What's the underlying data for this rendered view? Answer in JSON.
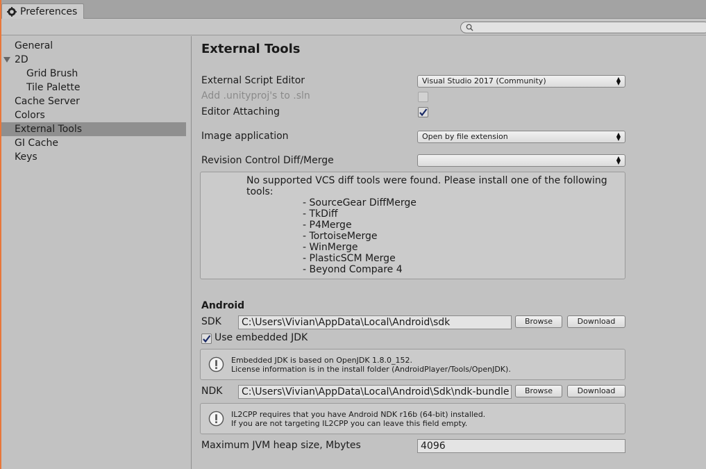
{
  "window": {
    "tab_title": "Preferences"
  },
  "search": {
    "placeholder": ""
  },
  "sidebar": {
    "items": [
      {
        "label": "General"
      },
      {
        "label": "2D"
      },
      {
        "label": "Grid Brush"
      },
      {
        "label": "Tile Palette"
      },
      {
        "label": "Cache Server"
      },
      {
        "label": "Colors"
      },
      {
        "label": "External Tools",
        "selected": true
      },
      {
        "label": "GI Cache"
      },
      {
        "label": "Keys"
      }
    ]
  },
  "main": {
    "title": "External Tools",
    "external_script_editor": {
      "label": "External Script Editor",
      "value": "Visual Studio 2017 (Community)"
    },
    "add_unityproj": {
      "label": "Add .unityproj's to .sln",
      "checked": false,
      "disabled": true
    },
    "editor_attaching": {
      "label": "Editor Attaching",
      "checked": true
    },
    "image_application": {
      "label": "Image application",
      "value": "Open by file extension"
    },
    "revision_control": {
      "label": "Revision Control Diff/Merge",
      "value": ""
    },
    "vcs_message": "No supported VCS diff tools were found. Please install one of the following tools:",
    "vcs_tools": [
      "- SourceGear DiffMerge",
      "- TkDiff",
      "- P4Merge",
      "- TortoiseMerge",
      "- WinMerge",
      "- PlasticSCM Merge",
      "- Beyond Compare 4"
    ],
    "android": {
      "heading": "Android",
      "sdk_label": "SDK",
      "sdk_path": "C:\\Users\\Vivian\\AppData\\Local\\Android\\sdk",
      "browse_label": "Browse",
      "download_label": "Download",
      "use_jdk_label": "Use embedded JDK",
      "use_jdk_checked": true,
      "jdk_info_line1": "Embedded JDK is based on OpenJDK 1.8.0_152.",
      "jdk_info_line2": "License information is in the install folder (AndroidPlayer/Tools/OpenJDK).",
      "ndk_label": "NDK",
      "ndk_path": "C:\\Users\\Vivian\\AppData\\Local\\Android\\Sdk\\ndk-bundle",
      "ndk_info_line1": "IL2CPP requires that you have Android NDK r16b (64-bit) installed.",
      "ndk_info_line2": "If you are not targeting IL2CPP you can leave this field empty.",
      "jvm_label": "Maximum JVM heap size, Mbytes",
      "jvm_value": "4096"
    }
  }
}
